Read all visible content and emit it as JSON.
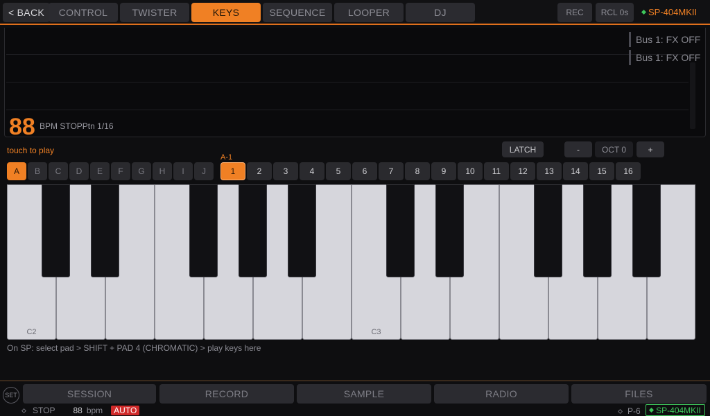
{
  "topnav": {
    "back_label": "< BACK",
    "tabs": [
      {
        "label": "CONTROL",
        "active": false
      },
      {
        "label": "TWISTER",
        "active": false
      },
      {
        "label": "KEYS",
        "active": true
      },
      {
        "label": "SEQUENCE",
        "active": false
      },
      {
        "label": "LOOPER",
        "active": false
      },
      {
        "label": "DJ",
        "active": false
      }
    ],
    "rec_label": "REC",
    "rcl_label": "RCL 0s",
    "device_label": "SP-404MKII",
    "accent_color": "#f08024"
  },
  "monitor": {
    "bpm": "88",
    "bpm_info": "BPM STOPPtn 1/16",
    "bus_log": [
      "Bus 1: FX OFF",
      "Bus 1: FX OFF"
    ]
  },
  "keys_controls": {
    "touch_label": "touch to play",
    "latch_label": "LATCH",
    "octave_down_label": "-",
    "octave_display": "OCT 0",
    "octave_up_label": "+",
    "current_pad_label": "A-1"
  },
  "banks": [
    "A",
    "B",
    "C",
    "D",
    "E",
    "F",
    "G",
    "H",
    "I",
    "J"
  ],
  "active_bank": "A",
  "pads": [
    "1",
    "2",
    "3",
    "4",
    "5",
    "6",
    "7",
    "8",
    "9",
    "10",
    "11",
    "12",
    "13",
    "14",
    "15",
    "16"
  ],
  "active_pad": "1",
  "keyboard": {
    "white_key_labels": [
      "C2",
      "",
      "",
      "",
      "",
      "",
      "",
      "C3",
      "",
      "",
      "",
      "",
      "",
      ""
    ]
  },
  "hint": "On SP: select pad > SHIFT + PAD 4 (CHROMATIC) > play keys here",
  "bottom_tabs": [
    "SESSION",
    "RECORD",
    "SAMPLE",
    "RADIO",
    "FILES"
  ],
  "bottom_set_label": "SET",
  "status": {
    "state": "STOP",
    "bpm": "88",
    "bpm_unit": "bpm",
    "auto_label": "AUTO",
    "pad": "P-6",
    "device": "SP-404MKII"
  },
  "icons": {
    "status_dot": "diamond-icon",
    "connected_dot": "green-diamond-icon"
  }
}
